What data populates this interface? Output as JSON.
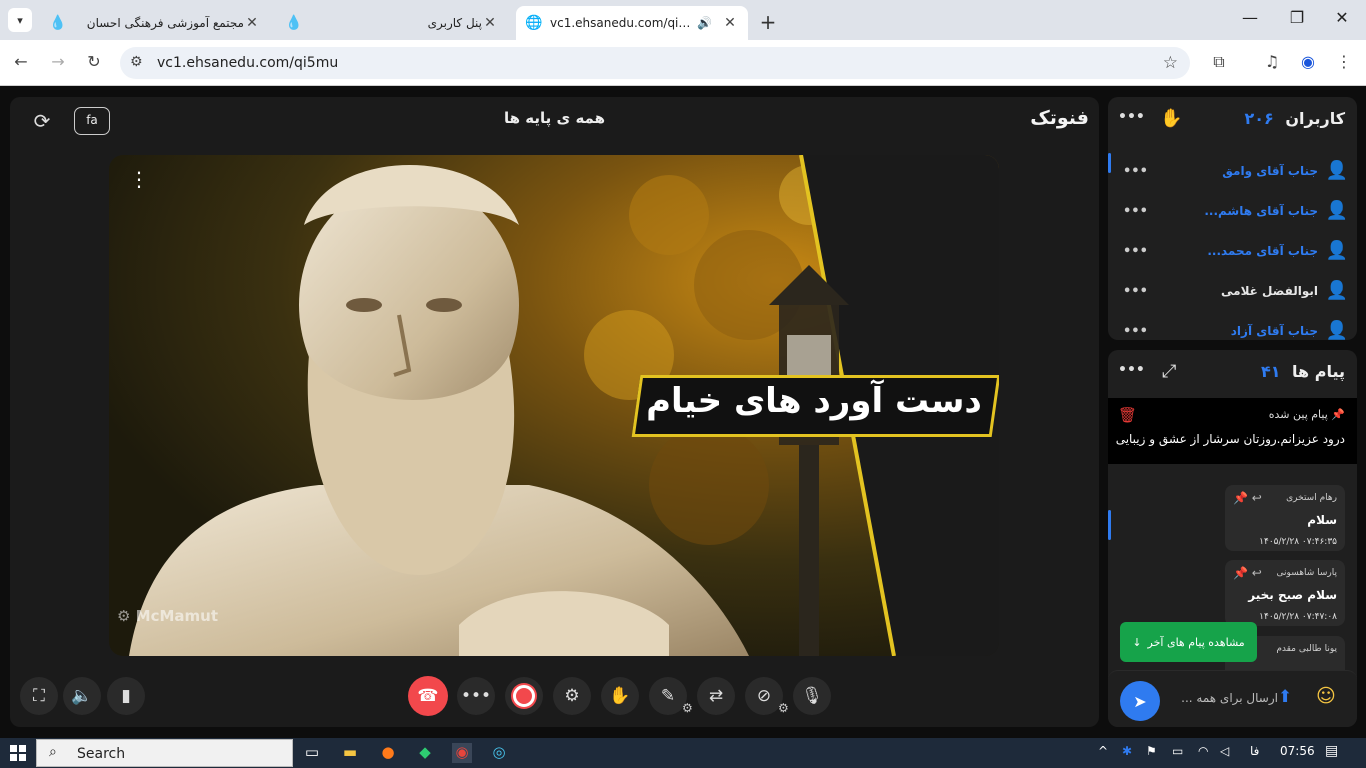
{
  "browser": {
    "tabs": [
      {
        "title": "مجتمع آموزشی فرهنگی احسان",
        "active": false
      },
      {
        "title": "پنل کاربری",
        "active": false
      },
      {
        "title": "vc1.ehsanedu.com/qi5mu",
        "active": true
      }
    ],
    "url": "vc1.ehsanedu.com/qi5mu"
  },
  "stage": {
    "lang_button": "fa",
    "title": "همه ی پایه ها",
    "brand": "فنوتک",
    "video": {
      "banner_text": "دست آورد های خیام",
      "watermark": "McMamut"
    }
  },
  "users_panel": {
    "title": "کاربران",
    "count": "۲۰۶",
    "users": [
      {
        "name": "جناب آقای وامق",
        "highlight": true
      },
      {
        "name": "جناب آقای هاشم...",
        "highlight": true
      },
      {
        "name": "جناب آقای محمد...",
        "highlight": true
      },
      {
        "name": "ابوالفضل غلامی",
        "highlight": false
      },
      {
        "name": "جناب آقای آزاد",
        "highlight": true
      }
    ]
  },
  "messages_panel": {
    "title": "پیام ها",
    "count": "۴۱",
    "pinned_label": "پیام پین شده",
    "pinned_text": "درود عزیزانم.روزتان سرشار از عشق و زیبایی",
    "messages": [
      {
        "sender": "رهام استخری",
        "text": "سلام",
        "time": "۱۴۰۵/۲/۲۸ ۰۷:۴۶:۳۵"
      },
      {
        "sender": "پارسا شاهسونی",
        "text": "سلام صبح بخیر",
        "time": "۱۴۰۵/۲/۲۸ ۰۷:۴۷:۰۸"
      },
      {
        "sender": "یونا طالبی مقدم",
        "text": "",
        "time": ""
      }
    ],
    "jump_label": "مشاهده پیام های آخر",
    "input_placeholder": "ارسال برای همه ..."
  },
  "taskbar": {
    "search_label": "Search",
    "lang": "فا",
    "clock": "07:56"
  },
  "colors": {
    "accent": "#2f7bf0",
    "danger": "#f2484c",
    "success": "#16a34a",
    "banner_border": "#e3c321"
  }
}
